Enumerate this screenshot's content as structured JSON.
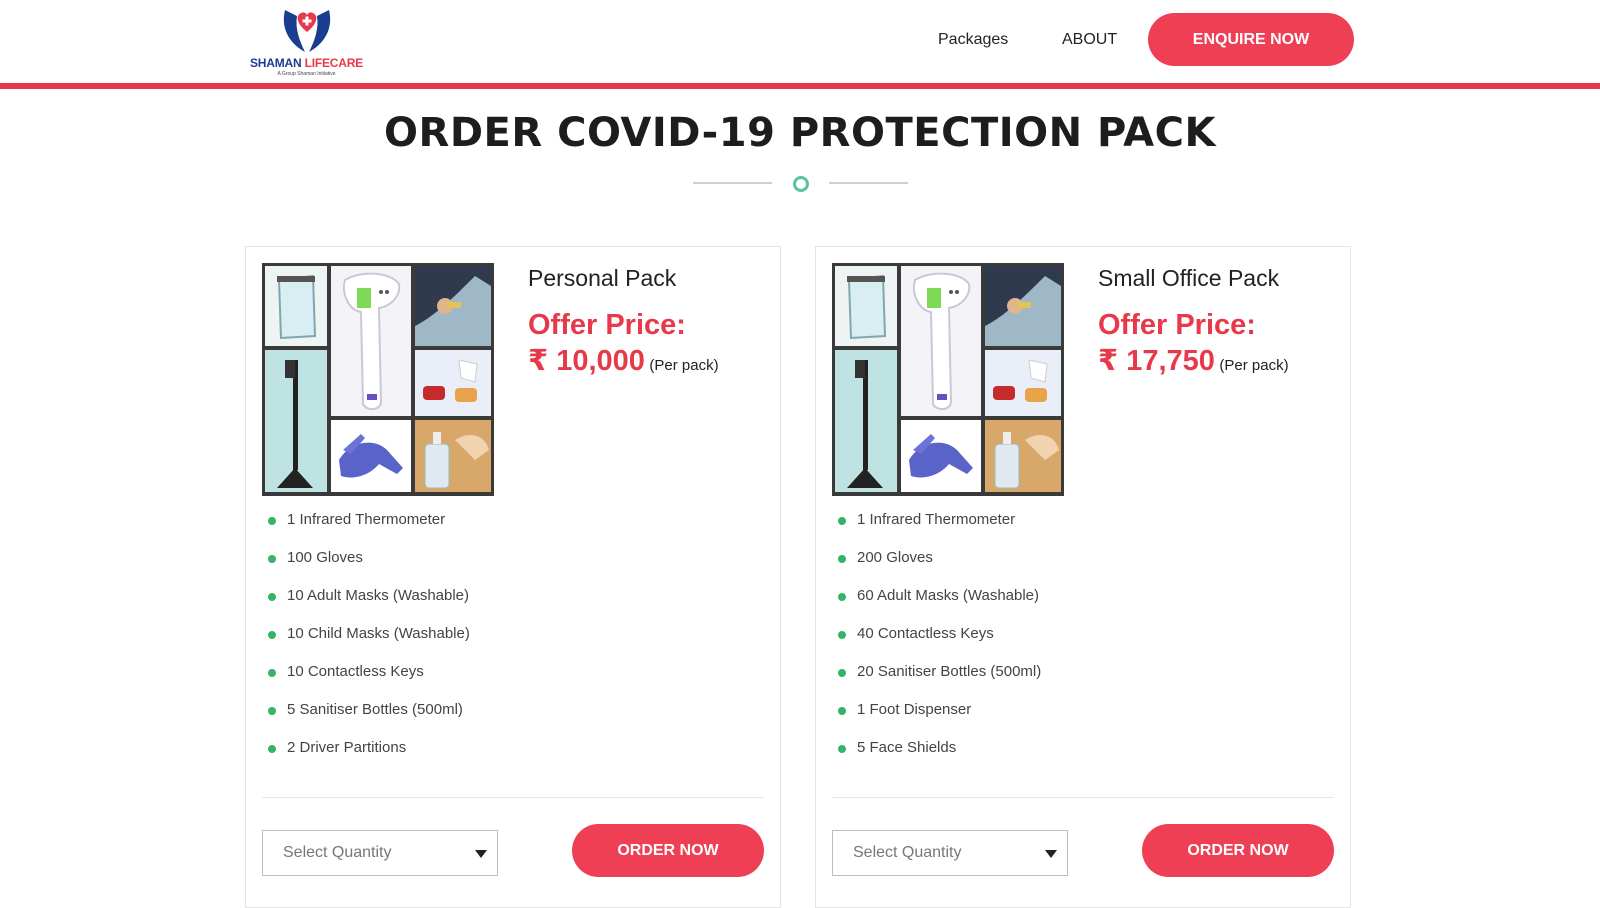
{
  "header": {
    "logo": {
      "brand_part1": "SHAMAN",
      "brand_part2": " LIFECARE",
      "tagline": "A Group Shaman Initiative",
      "icon": "heart-hands-icon"
    },
    "nav": [
      {
        "label": "Packages"
      },
      {
        "label": "ABOUT"
      }
    ],
    "cta_label": "ENQUIRE NOW"
  },
  "page": {
    "title": "ORDER COVID-19 PROTECTION PACK"
  },
  "colors": {
    "accent": "#ef3f55",
    "accent_line": "#e8394a",
    "bullet": "#36b36b",
    "divider_dot": "#5cc39a",
    "logo_blue": "#1b3d8f"
  },
  "packs": [
    {
      "name": "Personal Pack",
      "offer_label": "Offer Price:",
      "price": "₹ 10,000",
      "per_pack": "(Per pack)",
      "features": [
        "1 Infrared Thermometer",
        "100 Gloves",
        "10 Adult Masks (Washable)",
        "10 Child Masks (Washable)",
        "10 Contactless Keys",
        "5 Sanitiser Bottles (500ml)",
        "2 Driver Partitions"
      ],
      "select_placeholder": "Select Quantity",
      "order_label": "ORDER NOW"
    },
    {
      "name": "Small Office Pack",
      "offer_label": "Offer Price:",
      "price": "₹ 17,750",
      "per_pack": "(Per pack)",
      "features": [
        "1 Infrared Thermometer",
        "200 Gloves",
        "60 Adult Masks (Washable)",
        "40 Contactless Keys",
        "20 Sanitiser Bottles (500ml)",
        "1 Foot Dispenser",
        "5 Face Shields"
      ],
      "select_placeholder": "Select Quantity",
      "order_label": "ORDER NOW"
    }
  ]
}
